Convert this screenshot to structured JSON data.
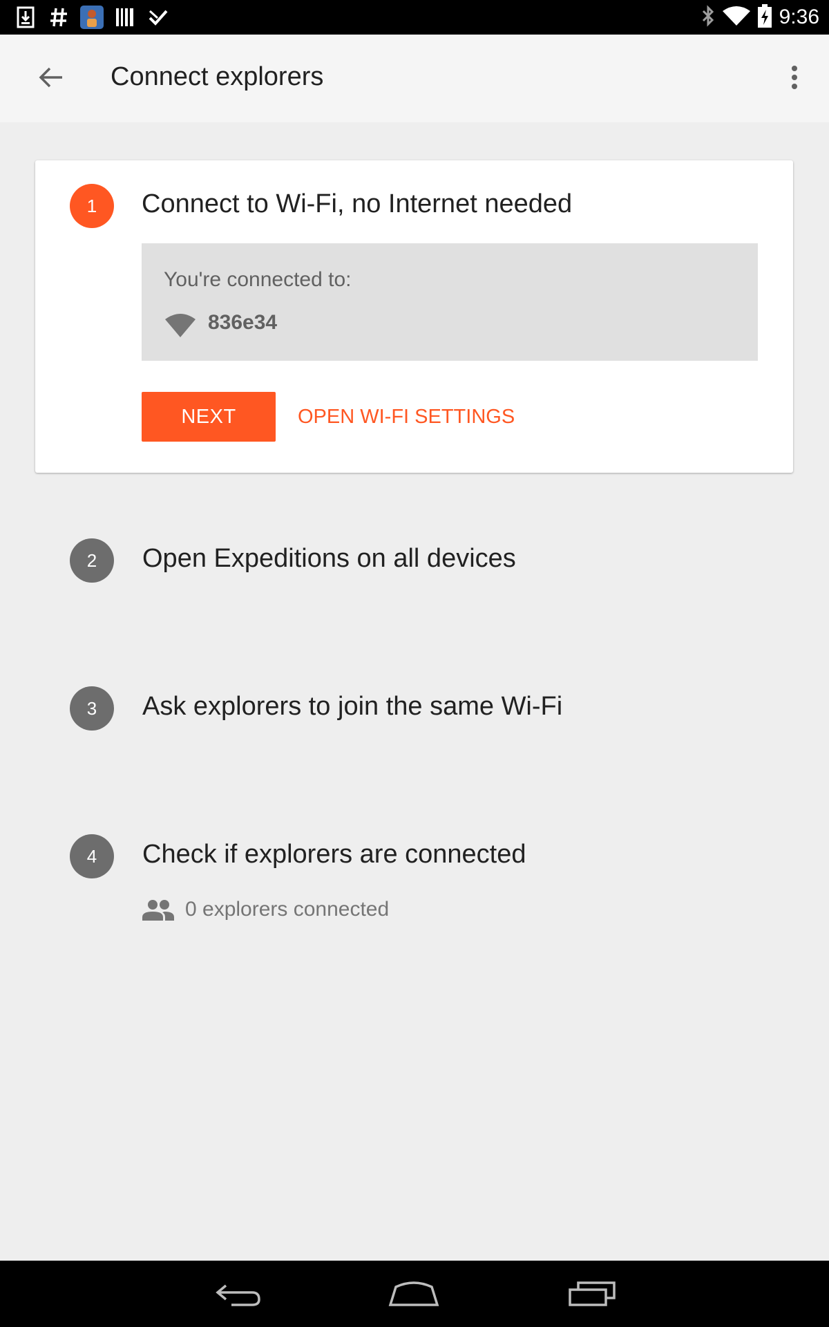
{
  "status_bar": {
    "time": "9:36",
    "left_icons": [
      "download-icon",
      "hash-icon",
      "app-avatar-icon",
      "barcode-icon",
      "checkmark-icon"
    ],
    "right_icons": [
      "bluetooth-icon",
      "wifi-signal-icon",
      "battery-charging-icon"
    ]
  },
  "app_bar": {
    "title": "Connect explorers",
    "back_icon": "arrow-back-icon",
    "menu_icon": "more-vert-icon"
  },
  "steps": [
    {
      "number": "1",
      "title": "Connect to Wi-Fi, no Internet needed",
      "state": "active",
      "connected_label": "You're connected to:",
      "network_name": "836e34",
      "next_label": "NEXT",
      "wifi_settings_label": "OPEN WI-FI SETTINGS"
    },
    {
      "number": "2",
      "title": "Open Expeditions on all devices",
      "state": "inactive"
    },
    {
      "number": "3",
      "title": "Ask explorers to join the same Wi-Fi",
      "state": "inactive"
    },
    {
      "number": "4",
      "title": "Check if explorers are connected",
      "state": "inactive",
      "connected_count_text": "0 explorers connected"
    }
  ],
  "nav_bar": {
    "icons": [
      "nav-back-icon",
      "nav-home-icon",
      "nav-recents-icon"
    ]
  },
  "colors": {
    "accent": "#ff5722",
    "inactive_step": "#6d6d6d",
    "background": "#eeeeee",
    "app_bar": "#f5f5f5"
  }
}
